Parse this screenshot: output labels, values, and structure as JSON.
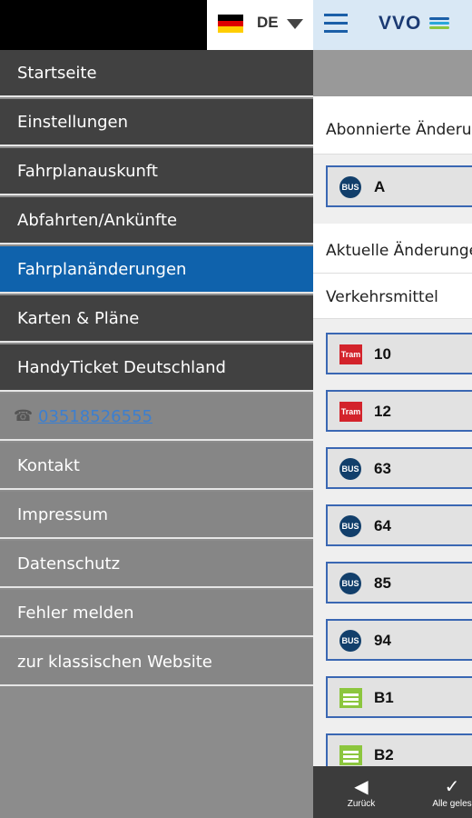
{
  "language": {
    "code": "DE",
    "flag_colors": [
      "#000000",
      "#dd0000",
      "#ffce00"
    ]
  },
  "appbar": {
    "logo_text": "VVO",
    "logo_colors": [
      "#1b5fa8",
      "#2aa7d8",
      "#8cc63e"
    ]
  },
  "menu": {
    "items": [
      "Startseite",
      "Einstellungen",
      "Fahrplanauskunft",
      "Abfahrten/Ankünfte",
      "Fahrplanänderungen",
      "Karten & Pläne",
      "HandyTicket Deutschland"
    ],
    "active_index": 4,
    "phone": "03518526555",
    "secondary_items": [
      "Kontakt",
      "Impressum",
      "Datenschutz",
      "Fehler melden",
      "zur klassischen Website"
    ]
  },
  "main": {
    "subscribed_title": "Abonnierte Änderu",
    "subscribed": [
      {
        "type": "bus",
        "icon_text": "BUS",
        "label": "A"
      }
    ],
    "current_title": "Aktuelle Änderunge",
    "filter_label": "Verkehrsmittel",
    "lines": [
      {
        "type": "tram",
        "icon_text": "Tram",
        "label": "10"
      },
      {
        "type": "tram",
        "icon_text": "Tram",
        "label": "12"
      },
      {
        "type": "bus",
        "icon_text": "BUS",
        "label": "63"
      },
      {
        "type": "bus",
        "icon_text": "BUS",
        "label": "64"
      },
      {
        "type": "bus",
        "icon_text": "BUS",
        "label": "85"
      },
      {
        "type": "bus",
        "icon_text": "BUS",
        "label": "94"
      },
      {
        "type": "bahn",
        "icon_text": "",
        "label": "B1"
      },
      {
        "type": "bahn",
        "icon_text": "",
        "label": "B2"
      }
    ]
  },
  "bottombar": {
    "back_label": "Zurück",
    "read_all_label": "Alle geles"
  },
  "colors": {
    "accent": "#0f62ac",
    "menu_dark": "#414141",
    "link": "#3c7fd0",
    "tram": "#d3232b",
    "bus": "#123f6b",
    "bahn": "#8cc63e"
  }
}
